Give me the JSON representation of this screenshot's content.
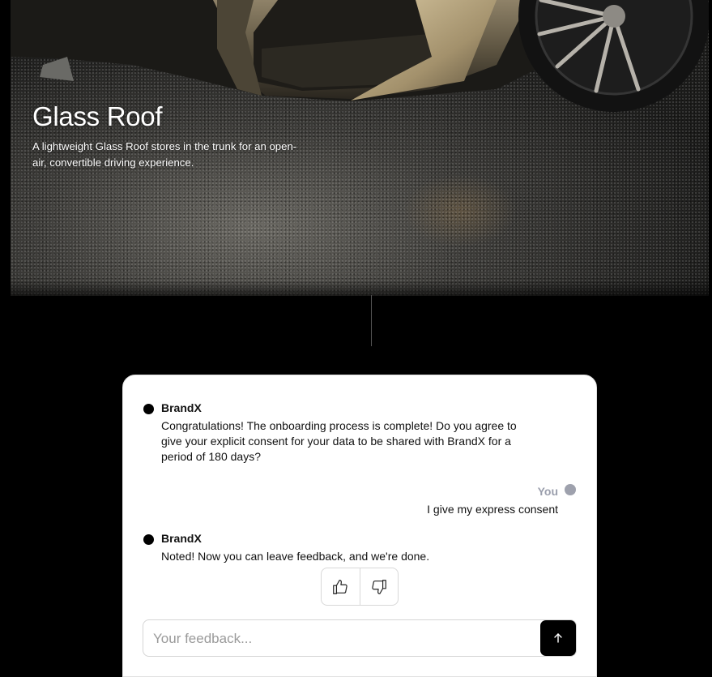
{
  "hero": {
    "title": "Glass Roof",
    "description": "A lightweight Glass Roof stores in the trunk for an open-air, convertible driving experience."
  },
  "chat": {
    "messages": [
      {
        "sender": "BrandX",
        "text": "Congratulations! The onboarding process is complete! Do you agree to give your explicit consent for your data to be shared with BrandX for a period of 180 days?"
      },
      {
        "sender": "You",
        "text": "I give my express consent"
      },
      {
        "sender": "BrandX",
        "text": "Noted! Now you can leave feedback, and we're done."
      }
    ],
    "feedback_buttons": [
      "thumbs-up-icon",
      "thumbs-down-icon"
    ],
    "input": {
      "placeholder": "Your feedback...",
      "value": ""
    },
    "send_icon": "arrow-up-icon"
  },
  "colors": {
    "background": "#000000",
    "card": "#ffffff",
    "bot_dot": "#000000",
    "user_dot": "#9ea1ad",
    "user_label": "#9a9eac",
    "send_button": "#000000"
  }
}
